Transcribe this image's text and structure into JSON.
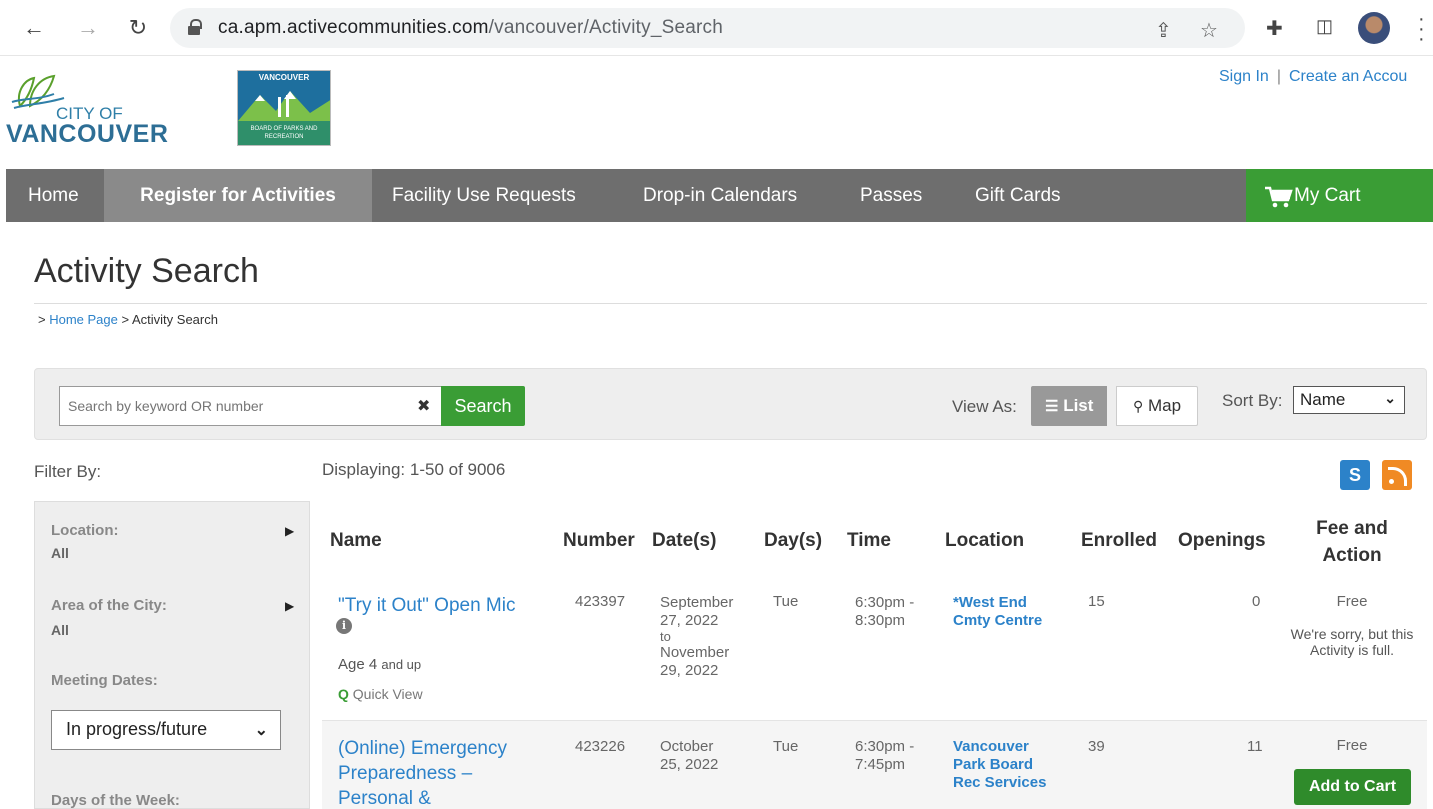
{
  "browser": {
    "url_host": "ca.apm.activecommunities.com",
    "url_path": "/vancouver/Activity_Search"
  },
  "header": {
    "logo_city_of": "CITY OF",
    "logo_vancouver": "VANCOUVER",
    "logo_parks_top": "VANCOUVER",
    "logo_parks_bottom": "BOARD OF PARKS AND RECREATION",
    "sign_in": "Sign In",
    "separator": "|",
    "create_account": "Create an Accou"
  },
  "nav": {
    "items": [
      {
        "label": "Home"
      },
      {
        "label": "Register for Activities"
      },
      {
        "label": "Facility Use Requests"
      },
      {
        "label": "Drop-in Calendars"
      },
      {
        "label": "Passes"
      },
      {
        "label": "Gift Cards"
      }
    ],
    "cart": "My Cart"
  },
  "page": {
    "title": "Activity Search",
    "crumb_prefix": ">",
    "crumb_home": "Home Page",
    "crumb_current": "> Activity Search"
  },
  "search": {
    "placeholder": "Search by keyword OR number",
    "clear": "✖",
    "button": "Search",
    "view_as": "View As:",
    "list": "List",
    "map": "Map",
    "sort_by": "Sort By:",
    "sort_value": "Name"
  },
  "filters": {
    "heading": "Filter By:",
    "location_label": "Location:",
    "location_value": "All",
    "area_label": "Area of the City:",
    "area_value": "All",
    "meeting_label": "Meeting Dates:",
    "meeting_value": "In progress/future",
    "days_label": "Days of the Week:"
  },
  "results": {
    "displaying": "Displaying: 1-50 of 9006",
    "columns": {
      "name": "Name",
      "number": "Number",
      "dates": "Date(s)",
      "days": "Day(s)",
      "time": "Time",
      "location": "Location",
      "enrolled": "Enrolled",
      "openings": "Openings",
      "fee_line1": "Fee and",
      "fee_line2": "Action"
    },
    "rows": [
      {
        "name": "\"Try it Out\" Open Mic",
        "age_prefix": "Age 4",
        "age_suffix": "and up",
        "quick_view": "Quick View",
        "number": "423397",
        "dates": [
          "September",
          "27, 2022",
          "to",
          "November",
          "29, 2022"
        ],
        "days": "Tue",
        "time": [
          "6:30pm -",
          "8:30pm"
        ],
        "location": [
          "*West End",
          "Cmty Centre"
        ],
        "enrolled": "15",
        "openings": "0",
        "fee": "Free",
        "note": "We're sorry, but this Activity is full."
      },
      {
        "name_lines": [
          "(Online) Emergency",
          "Preparedness –",
          "Personal &"
        ],
        "number": "423226",
        "dates": [
          "October",
          "25, 2022"
        ],
        "days": "Tue",
        "time": [
          "6:30pm -",
          "7:45pm"
        ],
        "location": [
          "Vancouver",
          "Park Board",
          "Rec Services"
        ],
        "enrolled": "39",
        "openings": "11",
        "fee": "Free",
        "action": "Add to Cart"
      }
    ]
  }
}
